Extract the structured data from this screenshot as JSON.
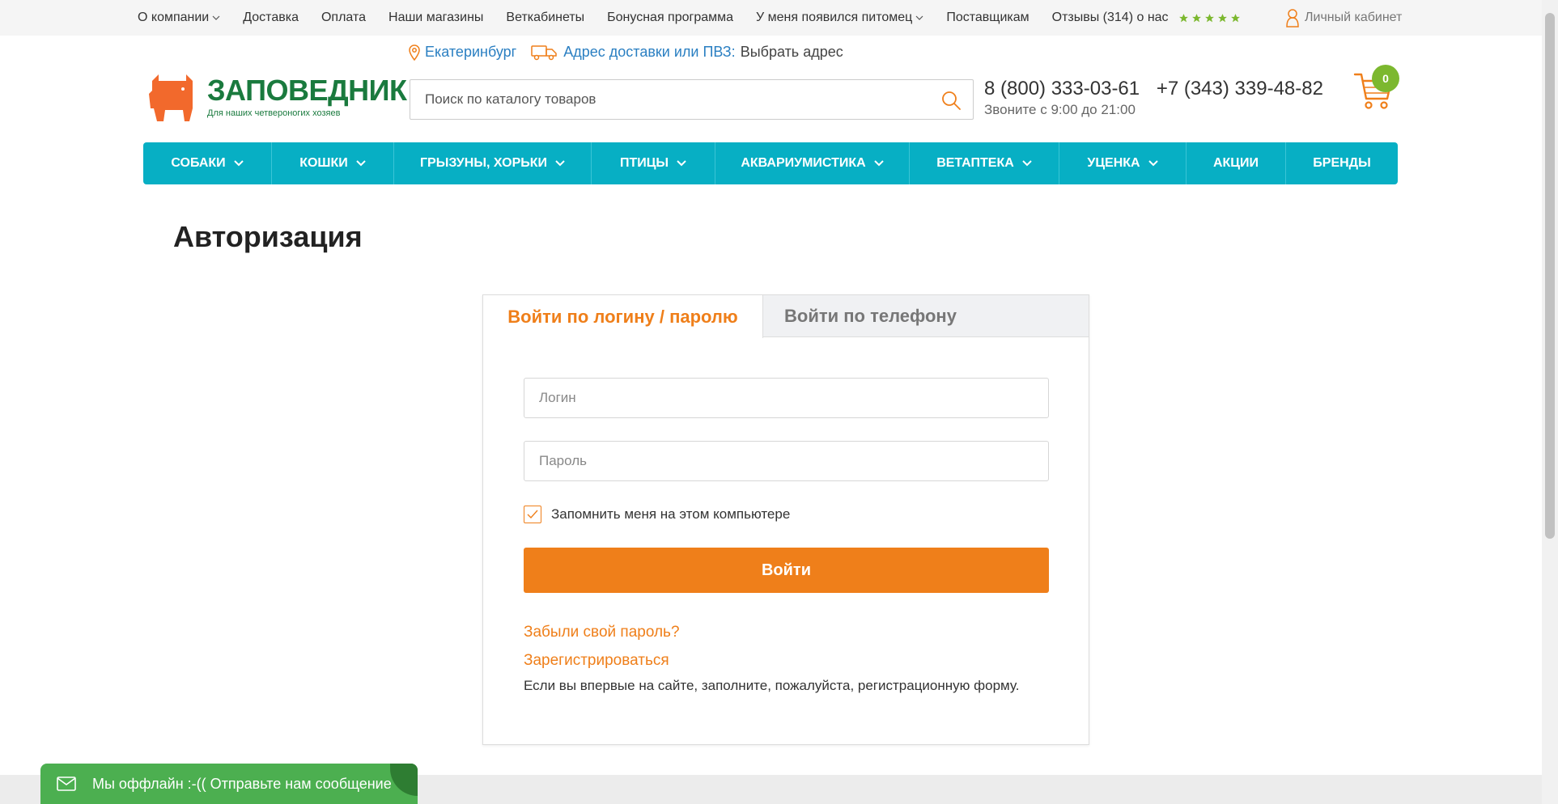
{
  "topnav": {
    "items": [
      {
        "label": "О компании",
        "dropdown": true
      },
      {
        "label": "Доставка",
        "dropdown": false
      },
      {
        "label": "Оплата",
        "dropdown": false
      },
      {
        "label": "Наши магазины",
        "dropdown": false
      },
      {
        "label": "Веткабинеты",
        "dropdown": false
      },
      {
        "label": "Бонусная программа",
        "dropdown": false
      },
      {
        "label": "У меня появился питомец",
        "dropdown": true
      },
      {
        "label": "Поставщикам",
        "dropdown": false
      },
      {
        "label": "Отзывы (314) о нас",
        "dropdown": false
      }
    ],
    "rating_stars": 5,
    "cabinet_label": "Личный кабинет"
  },
  "header": {
    "logo_text": "ЗАПОВЕДНИК",
    "logo_tagline": "Для наших четвероногих хозяев",
    "city": "Екатеринбург",
    "delivery_label": "Адрес доставки или ПВЗ:",
    "delivery_choose": "Выбрать адрес",
    "search_placeholder": "Поиск по каталогу товаров",
    "phone_1": "8 (800) 333-03-61",
    "phone_2": "+7 (343) 339-48-82",
    "hours": "Звоните с 9:00 до 21:00",
    "cart_count": "0"
  },
  "mainnav": {
    "items": [
      {
        "label": "СОБАКИ",
        "dropdown": true
      },
      {
        "label": "КОШКИ",
        "dropdown": true
      },
      {
        "label": "ГРЫЗУНЫ, ХОРЬКИ",
        "dropdown": true
      },
      {
        "label": "ПТИЦЫ",
        "dropdown": true
      },
      {
        "label": "АКВАРИУМИСТИКА",
        "dropdown": true
      },
      {
        "label": "ВЕТАПТЕКА",
        "dropdown": true
      },
      {
        "label": "УЦЕНКА",
        "dropdown": true
      },
      {
        "label": "АКЦИИ",
        "dropdown": false
      },
      {
        "label": "БРЕНДЫ",
        "dropdown": false
      }
    ]
  },
  "page": {
    "title": "Авторизация"
  },
  "auth": {
    "tab_login": "Войти по логину / паролю",
    "tab_phone": "Войти по телефону",
    "login_placeholder": "Логин",
    "password_placeholder": "Пароль",
    "remember_label": "Запомнить меня на этом компьютере",
    "remember_checked": true,
    "submit_label": "Войти",
    "forgot_label": "Забыли свой пароль?",
    "register_label": "Зарегистрироваться",
    "register_note": "Если вы впервые на сайте, заполните, пожалуйста, регистрационную форму."
  },
  "chat": {
    "text": "Мы оффлайн :-(( Отправьте нам сообщение"
  },
  "colors": {
    "accent_orange": "#ef7f1a",
    "nav_teal": "#07afc4",
    "brand_green": "#1a7a3e",
    "link_blue": "#2a7fc2",
    "star_green": "#7cb82f",
    "chat_green": "#4caf50"
  }
}
